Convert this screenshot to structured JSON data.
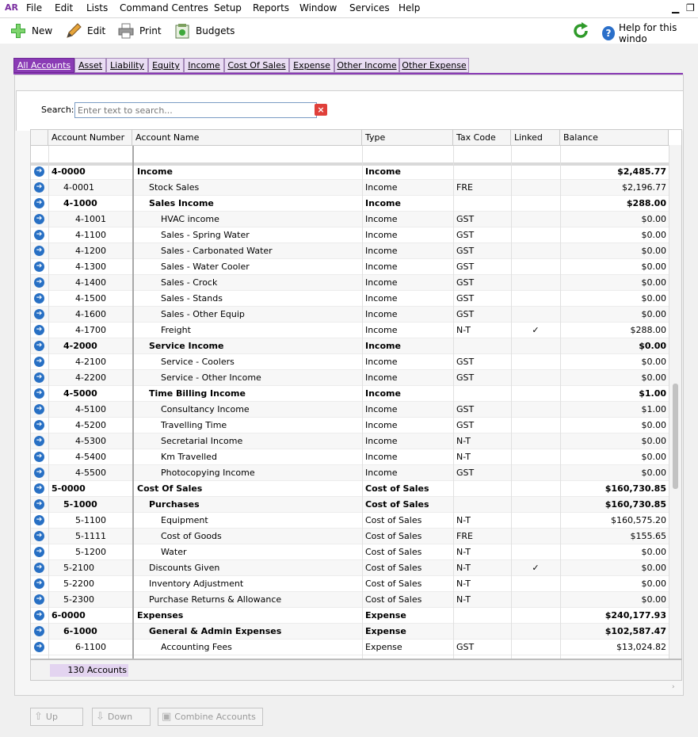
{
  "app": {
    "logo": "AR"
  },
  "menu": [
    "File",
    "Edit",
    "Lists",
    "Command Centres",
    "Setup",
    "Reports",
    "Window",
    "Services",
    "Help"
  ],
  "window_controls": {
    "minimize": "▁",
    "restore": "❐"
  },
  "toolbar": {
    "new": "New",
    "edit": "Edit",
    "print": "Print",
    "budgets": "Budgets",
    "help": "Help for this windo"
  },
  "tabs": [
    {
      "label": "All Accounts",
      "active": true
    },
    {
      "label": "Asset"
    },
    {
      "label": "Liability"
    },
    {
      "label": "Equity"
    },
    {
      "label": "Income"
    },
    {
      "label": "Cost Of Sales"
    },
    {
      "label": "Expense"
    },
    {
      "label": "Other Income"
    },
    {
      "label": "Other Expense"
    }
  ],
  "search": {
    "label": "Search:",
    "placeholder": "Enter text to search..."
  },
  "columns": {
    "number": "Account Number",
    "name": "Account Name",
    "type": "Type",
    "tax": "Tax Code",
    "linked": "Linked",
    "balance": "Balance"
  },
  "accounts": [
    {
      "num": "4-0000",
      "name": "Income",
      "type": "Income",
      "tax": "",
      "linked": "",
      "bal": "$2,485.77",
      "level": 0,
      "bold": true
    },
    {
      "num": "4-0001",
      "name": "Stock Sales",
      "type": "Income",
      "tax": "FRE",
      "linked": "",
      "bal": "$2,196.77",
      "level": 1,
      "bold": false
    },
    {
      "num": "4-1000",
      "name": "Sales Income",
      "type": "Income",
      "tax": "",
      "linked": "",
      "bal": "$288.00",
      "level": 1,
      "bold": true
    },
    {
      "num": "4-1001",
      "name": "HVAC income",
      "type": "Income",
      "tax": "GST",
      "linked": "",
      "bal": "$0.00",
      "level": 2,
      "bold": false
    },
    {
      "num": "4-1100",
      "name": "Sales - Spring Water",
      "type": "Income",
      "tax": "GST",
      "linked": "",
      "bal": "$0.00",
      "level": 2,
      "bold": false
    },
    {
      "num": "4-1200",
      "name": "Sales - Carbonated Water",
      "type": "Income",
      "tax": "GST",
      "linked": "",
      "bal": "$0.00",
      "level": 2,
      "bold": false
    },
    {
      "num": "4-1300",
      "name": "Sales - Water Cooler",
      "type": "Income",
      "tax": "GST",
      "linked": "",
      "bal": "$0.00",
      "level": 2,
      "bold": false
    },
    {
      "num": "4-1400",
      "name": "Sales - Crock",
      "type": "Income",
      "tax": "GST",
      "linked": "",
      "bal": "$0.00",
      "level": 2,
      "bold": false
    },
    {
      "num": "4-1500",
      "name": "Sales - Stands",
      "type": "Income",
      "tax": "GST",
      "linked": "",
      "bal": "$0.00",
      "level": 2,
      "bold": false
    },
    {
      "num": "4-1600",
      "name": "Sales - Other Equip",
      "type": "Income",
      "tax": "GST",
      "linked": "",
      "bal": "$0.00",
      "level": 2,
      "bold": false
    },
    {
      "num": "4-1700",
      "name": "Freight",
      "type": "Income",
      "tax": "N-T",
      "linked": "✓",
      "bal": "$288.00",
      "level": 2,
      "bold": false
    },
    {
      "num": "4-2000",
      "name": "Service Income",
      "type": "Income",
      "tax": "",
      "linked": "",
      "bal": "$0.00",
      "level": 1,
      "bold": true
    },
    {
      "num": "4-2100",
      "name": "Service - Coolers",
      "type": "Income",
      "tax": "GST",
      "linked": "",
      "bal": "$0.00",
      "level": 2,
      "bold": false
    },
    {
      "num": "4-2200",
      "name": "Service - Other Income",
      "type": "Income",
      "tax": "GST",
      "linked": "",
      "bal": "$0.00",
      "level": 2,
      "bold": false
    },
    {
      "num": "4-5000",
      "name": "Time Billing Income",
      "type": "Income",
      "tax": "",
      "linked": "",
      "bal": "$1.00",
      "level": 1,
      "bold": true
    },
    {
      "num": "4-5100",
      "name": "Consultancy Income",
      "type": "Income",
      "tax": "GST",
      "linked": "",
      "bal": "$1.00",
      "level": 2,
      "bold": false
    },
    {
      "num": "4-5200",
      "name": "Travelling Time",
      "type": "Income",
      "tax": "GST",
      "linked": "",
      "bal": "$0.00",
      "level": 2,
      "bold": false
    },
    {
      "num": "4-5300",
      "name": "Secretarial Income",
      "type": "Income",
      "tax": "N-T",
      "linked": "",
      "bal": "$0.00",
      "level": 2,
      "bold": false
    },
    {
      "num": "4-5400",
      "name": "Km Travelled",
      "type": "Income",
      "tax": "N-T",
      "linked": "",
      "bal": "$0.00",
      "level": 2,
      "bold": false
    },
    {
      "num": "4-5500",
      "name": "Photocopying Income",
      "type": "Income",
      "tax": "GST",
      "linked": "",
      "bal": "$0.00",
      "level": 2,
      "bold": false
    },
    {
      "num": "5-0000",
      "name": "Cost Of Sales",
      "type": "Cost of Sales",
      "tax": "",
      "linked": "",
      "bal": "$160,730.85",
      "level": 0,
      "bold": true
    },
    {
      "num": "5-1000",
      "name": "Purchases",
      "type": "Cost of Sales",
      "tax": "",
      "linked": "",
      "bal": "$160,730.85",
      "level": 1,
      "bold": true
    },
    {
      "num": "5-1100",
      "name": "Equipment",
      "type": "Cost of Sales",
      "tax": "N-T",
      "linked": "",
      "bal": "$160,575.20",
      "level": 2,
      "bold": false
    },
    {
      "num": "5-1111",
      "name": "Cost of Goods",
      "type": "Cost of Sales",
      "tax": "FRE",
      "linked": "",
      "bal": "$155.65",
      "level": 2,
      "bold": false
    },
    {
      "num": "5-1200",
      "name": "Water",
      "type": "Cost of Sales",
      "tax": "N-T",
      "linked": "",
      "bal": "$0.00",
      "level": 2,
      "bold": false
    },
    {
      "num": "5-2100",
      "name": "Discounts Given",
      "type": "Cost of Sales",
      "tax": "N-T",
      "linked": "✓",
      "bal": "$0.00",
      "level": 1,
      "bold": false
    },
    {
      "num": "5-2200",
      "name": "Inventory Adjustment",
      "type": "Cost of Sales",
      "tax": "N-T",
      "linked": "",
      "bal": "$0.00",
      "level": 1,
      "bold": false
    },
    {
      "num": "5-2300",
      "name": "Purchase Returns & Allowance",
      "type": "Cost of Sales",
      "tax": "N-T",
      "linked": "",
      "bal": "$0.00",
      "level": 1,
      "bold": false
    },
    {
      "num": "6-0000",
      "name": "Expenses",
      "type": "Expense",
      "tax": "",
      "linked": "",
      "bal": "$240,177.93",
      "level": 0,
      "bold": true
    },
    {
      "num": "6-1000",
      "name": "General & Admin Expenses",
      "type": "Expense",
      "tax": "",
      "linked": "",
      "bal": "$102,587.47",
      "level": 1,
      "bold": true
    },
    {
      "num": "6-1100",
      "name": "Accounting Fees",
      "type": "Expense",
      "tax": "GST",
      "linked": "",
      "bal": "$13,024.82",
      "level": 2,
      "bold": false
    }
  ],
  "footer": {
    "count": "130 Accounts"
  },
  "bottom_buttons": {
    "up": "Up",
    "down": "Down",
    "combine": "Combine Accounts"
  },
  "colors": {
    "accent": "#8a3bb5",
    "arrow": "#2870c4"
  }
}
